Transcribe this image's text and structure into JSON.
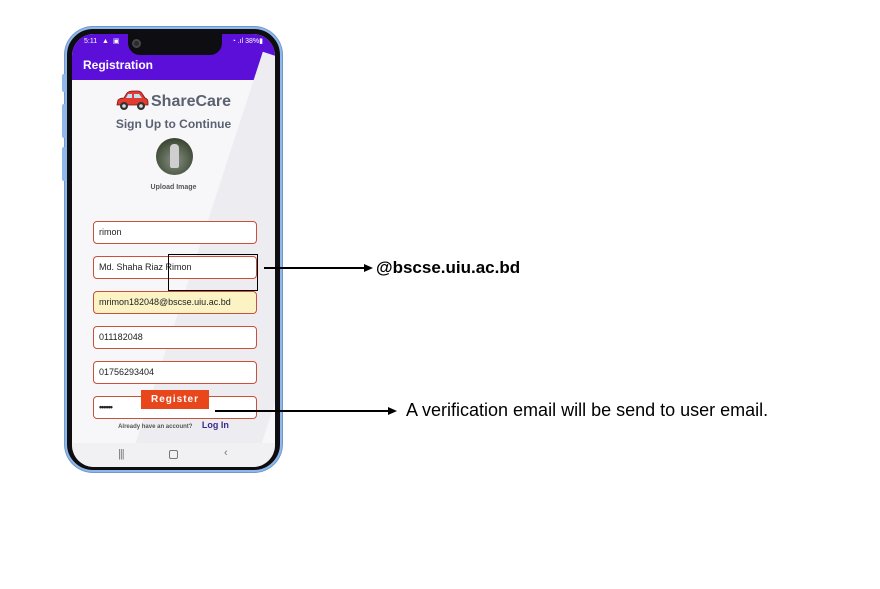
{
  "status_bar": {
    "time": "5:11",
    "left_icons": "▲ ▣",
    "right_text": "◔ .ıl 38%▮"
  },
  "app_bar": {
    "title": "Registration"
  },
  "logo": {
    "text": "ShareCare"
  },
  "subtitle": "Sign Up to Continue",
  "upload_label": "Upload Image",
  "fields": {
    "username": "rimon",
    "full_name": "Md. Shaha Riaz Rimon",
    "email": "mrimon182048@bscse.uiu.ac.bd",
    "student_id": "011182048",
    "phone": "01756293404",
    "password": "••••••"
  },
  "register_button": "Register",
  "login_prompt": {
    "text": "Already have an account?",
    "link": "Log In"
  },
  "annotations": {
    "email_domain": "@bscse.uiu.ac.bd",
    "verification_note": "A verification email will be send to user email."
  },
  "colors": {
    "app_bar": "#5b0fd8",
    "field_border": "#c9503a",
    "register_button": "#e8461b",
    "email_highlight": "#fbf3c4"
  }
}
